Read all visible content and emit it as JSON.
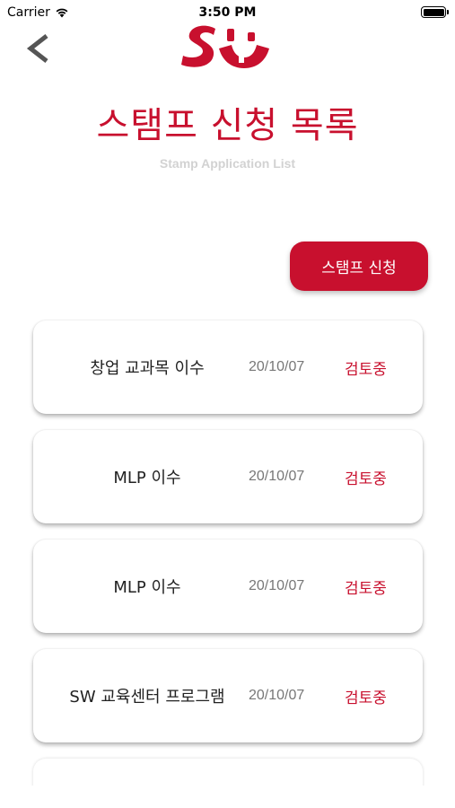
{
  "status_bar": {
    "carrier": "Carrier",
    "time": "3:50 PM",
    "battery_level": 1.0
  },
  "header": {
    "back_icon": "chevron-left-icon",
    "logo_text": "SW"
  },
  "page": {
    "title": "스탬프 신청 목록",
    "subtitle": "Stamp Application List",
    "apply_button_label": "스탬프 신청"
  },
  "applications": [
    {
      "name": "창업 교과목 이수",
      "date": "20/10/07",
      "status": "검토중"
    },
    {
      "name": "MLP 이수",
      "date": "20/10/07",
      "status": "검토중"
    },
    {
      "name": "MLP 이수",
      "date": "20/10/07",
      "status": "검토중"
    },
    {
      "name": "SW 교육센터 프로그램",
      "date": "20/10/07",
      "status": "검토중"
    }
  ],
  "colors": {
    "accent": "#c8102e",
    "subtitle": "#d2d2d2",
    "date": "#777777"
  }
}
